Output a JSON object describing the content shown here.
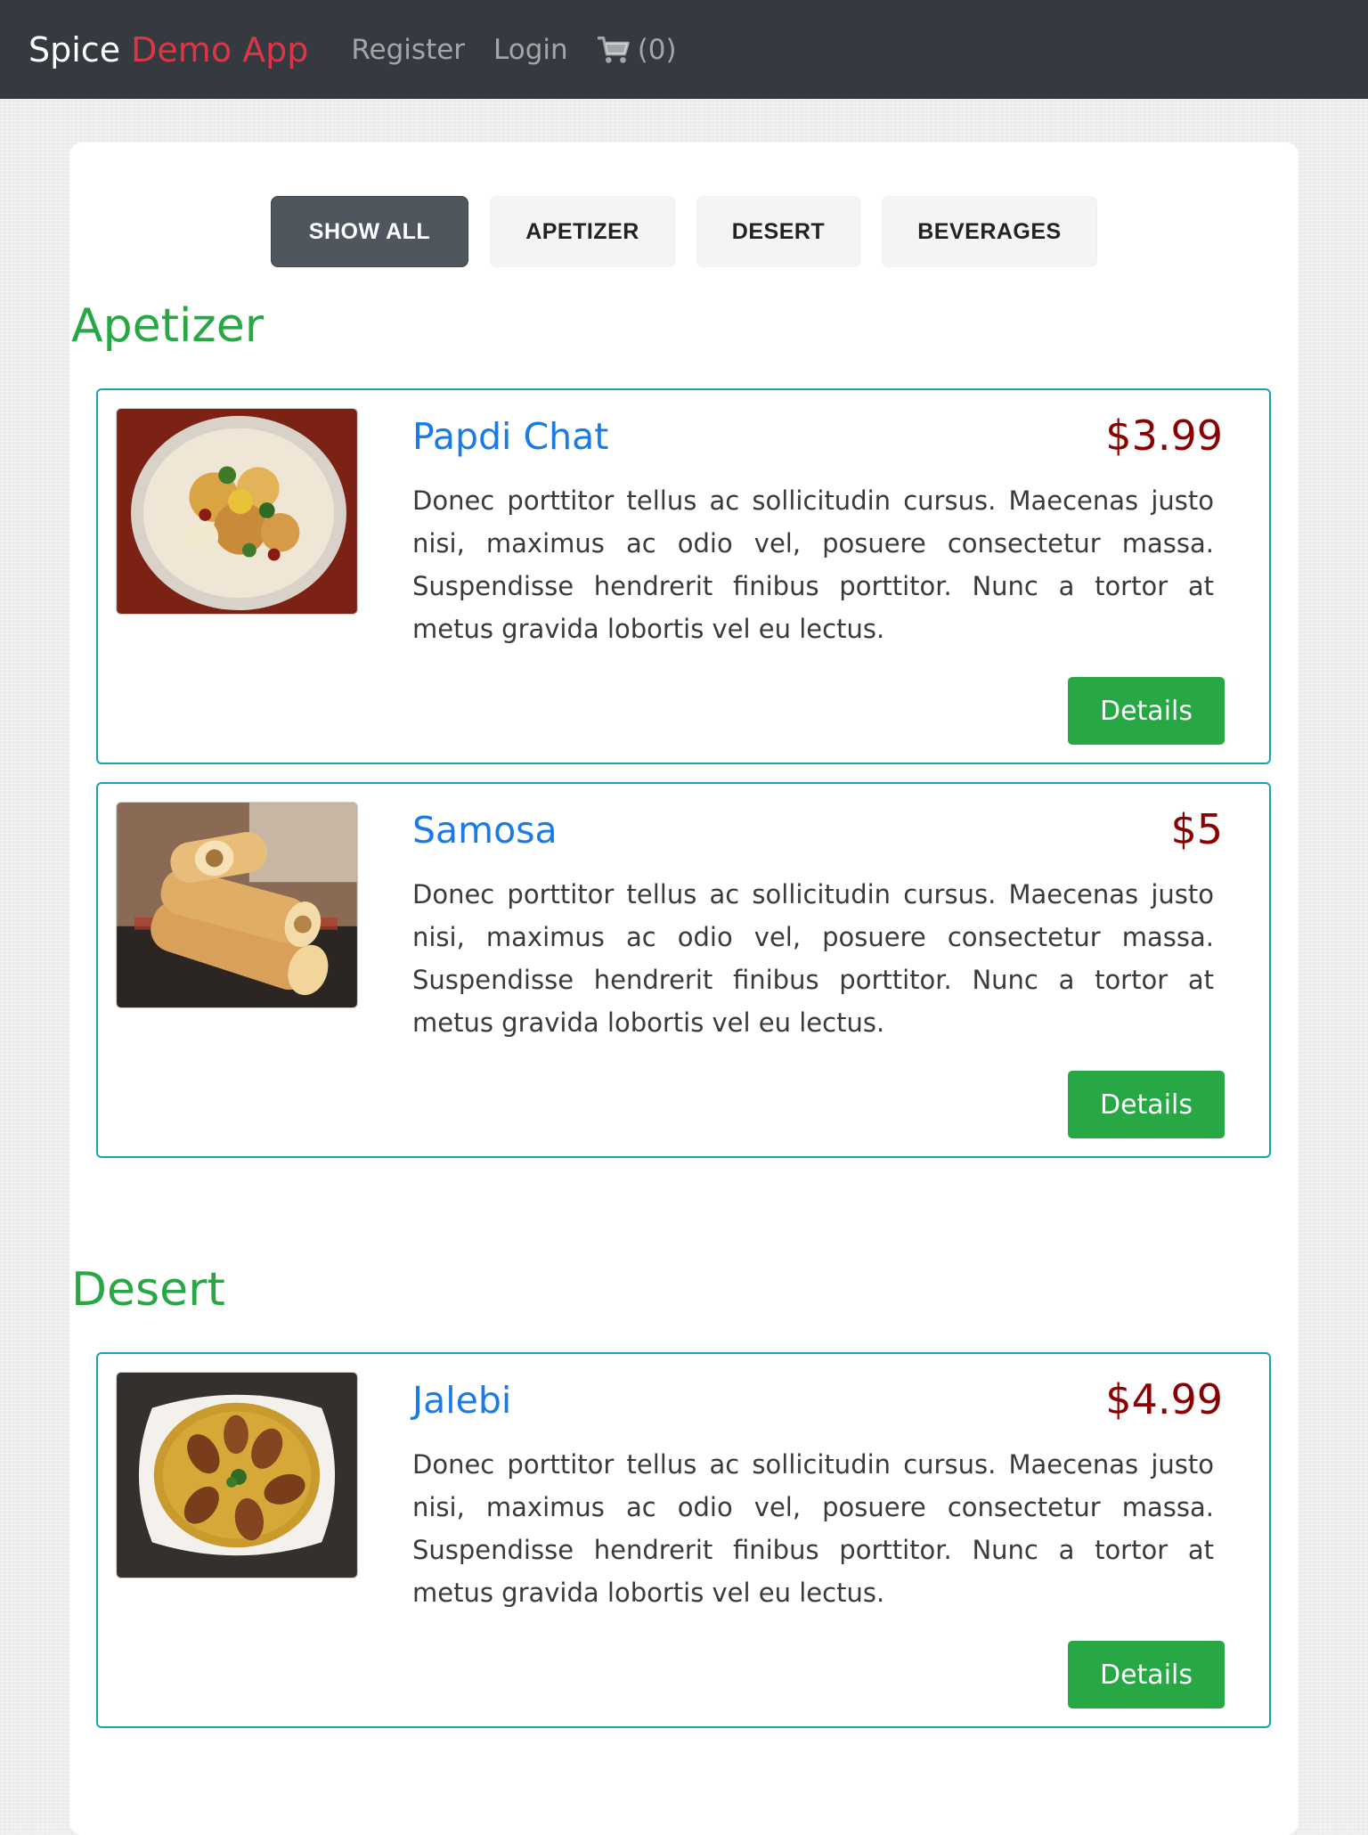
{
  "navbar": {
    "brand_part1": "Spice",
    "brand_part2": "Demo App",
    "register": "Register",
    "login": "Login",
    "cart_icon": "shopping-cart-icon",
    "cart_count": "(0)"
  },
  "filters": [
    {
      "label": "SHOW ALL",
      "active": true
    },
    {
      "label": "APETIZER",
      "active": false
    },
    {
      "label": "DESERT",
      "active": false
    },
    {
      "label": "BEVERAGES",
      "active": false
    }
  ],
  "sections": [
    {
      "title": "Apetizer",
      "items": [
        {
          "name": "Papdi Chat",
          "price": "$3.99",
          "description": "Donec porttitor tellus ac sollicitudin cursus. Maecenas justo nisi, maximus ac odio vel, posuere consectetur massa. Suspendisse hendrerit finibus porttitor. Nunc a tortor at metus gravida lobortis vel eu lectus.",
          "button": "Details"
        },
        {
          "name": "Samosa",
          "price": "$5",
          "description": "Donec porttitor tellus ac sollicitudin cursus. Maecenas justo nisi, maximus ac odio vel, posuere consectetur massa. Suspendisse hendrerit finibus porttitor. Nunc a tortor at metus gravida lobortis vel eu lectus.",
          "button": "Details"
        }
      ]
    },
    {
      "title": "Desert",
      "items": [
        {
          "name": "Jalebi",
          "price": "$4.99",
          "description": "Donec porttitor tellus ac sollicitudin cursus. Maecenas justo nisi, maximus ac odio vel, posuere consectetur massa. Suspendisse hendrerit finibus porttitor. Nunc a tortor at metus gravida lobortis vel eu lectus.",
          "button": "Details"
        }
      ]
    }
  ],
  "colors": {
    "navbar_bg": "#343a40",
    "brand_accent": "#dc3545",
    "section_title": "#28a745",
    "item_name": "#1a7be8",
    "price": "#8b0000",
    "details_button": "#28a745",
    "card_border": "#17a2b8"
  }
}
